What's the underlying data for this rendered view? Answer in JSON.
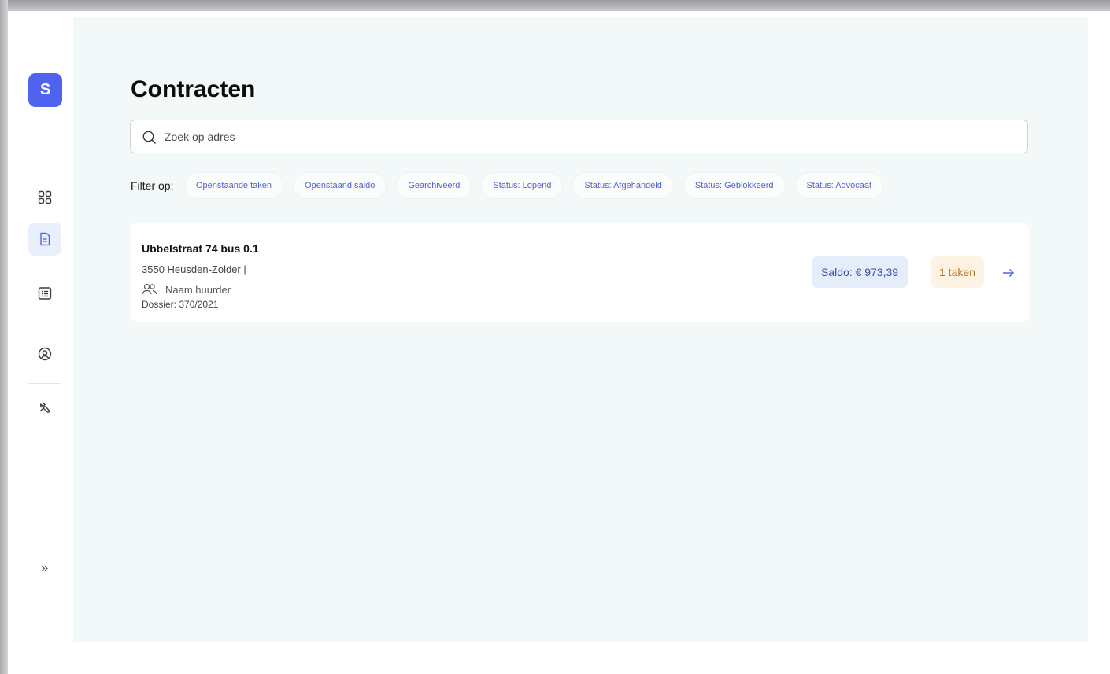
{
  "sidebar": {
    "logo_letter": "S",
    "items": [
      {
        "icon": "dashboard-grid-icon",
        "active": false
      },
      {
        "icon": "document-icon",
        "active": true
      },
      {
        "icon": "list-icon",
        "active": false
      },
      {
        "icon": "user-circle-icon",
        "active": false
      },
      {
        "icon": "tools-icon",
        "active": false
      }
    ],
    "expand_icon": "double-chevron-right-icon",
    "expand_label": "»"
  },
  "page": {
    "title": "Contracten"
  },
  "search": {
    "placeholder": "Zoek op adres",
    "value": ""
  },
  "filters": {
    "label": "Filter op:",
    "chips": [
      "Openstaande taken",
      "Openstaand saldo",
      "Gearchiveerd",
      "Status: Lopend",
      "Status: Afgehandeld",
      "Status: Geblokkeerd",
      "Status: Advocaat"
    ]
  },
  "contracts": [
    {
      "address": "Ubbelstraat 74 bus 0.1",
      "city": "3550 Heusden-Zolder |",
      "tenant": "Naam huurder",
      "dossier": "Dossier: 370/2021",
      "saldo": "Saldo: € 973,39",
      "tasks": "1 taken"
    }
  ],
  "colors": {
    "accent": "#4f63ee",
    "content_bg": "#f3f8f9",
    "saldo_bg": "#e5edfb",
    "tasks_bg": "#fdf3e2",
    "tasks_text": "#b9772d"
  }
}
